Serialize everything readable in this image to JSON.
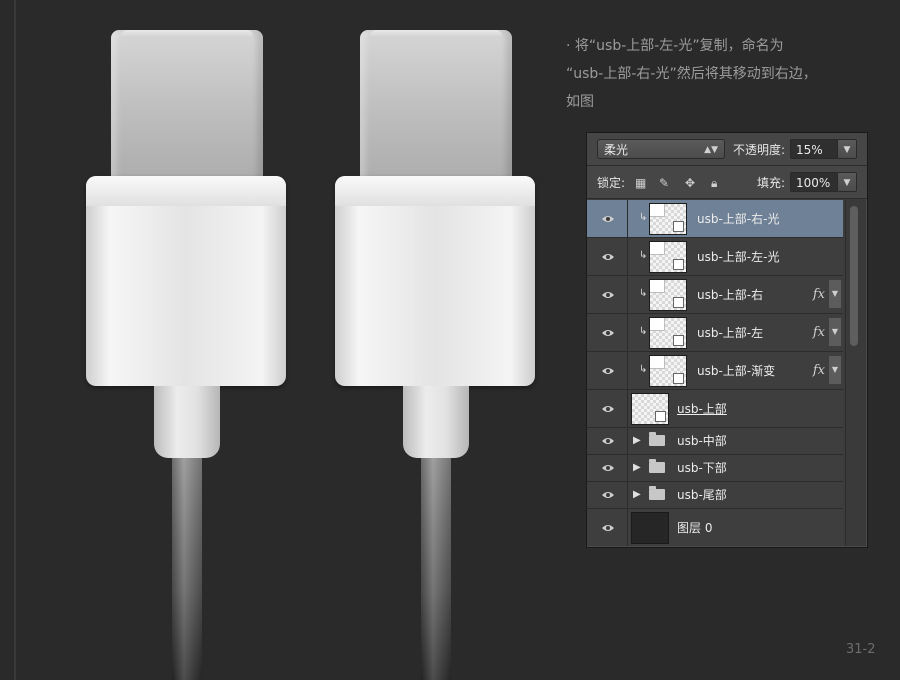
{
  "instruction": {
    "text": "· 将“usb-上部-左-光”复制，命名为\n“usb-上部-右-光”然后将其移动到右边，\n如图"
  },
  "layers_panel": {
    "blend_mode": "柔光",
    "opacity_label": "不透明度:",
    "opacity_value": "15%",
    "lock_label": "锁定:",
    "fill_label": "填充:",
    "fill_value": "100%",
    "fx_label": "fx",
    "layers": [
      {
        "name": "usb-上部-右-光",
        "selected": true,
        "clipped": true,
        "fx": false
      },
      {
        "name": "usb-上部-左-光",
        "selected": false,
        "clipped": true,
        "fx": false
      },
      {
        "name": "usb-上部-右",
        "selected": false,
        "clipped": true,
        "fx": true
      },
      {
        "name": "usb-上部-左",
        "selected": false,
        "clipped": true,
        "fx": true
      },
      {
        "name": "usb-上部-渐变",
        "selected": false,
        "clipped": true,
        "fx": true
      },
      {
        "name": "usb-上部",
        "selected": false,
        "clipped": false,
        "fx": false
      },
      {
        "name": "usb-中部",
        "type": "group"
      },
      {
        "name": "usb-下部",
        "type": "group"
      },
      {
        "name": "usb-尾部",
        "type": "group"
      },
      {
        "name": "图层 0",
        "type": "background"
      }
    ]
  },
  "page_number": "31-2",
  "colors": {
    "background": "#2a2a2a",
    "selected_layer": "#6f8196"
  },
  "icons": [
    "eye-icon",
    "clip-arrow-icon",
    "transparency-lock-icon",
    "brush-lock-icon",
    "move-lock-icon",
    "padlock-icon",
    "folder-icon",
    "disclosure-triangle-icon"
  ]
}
